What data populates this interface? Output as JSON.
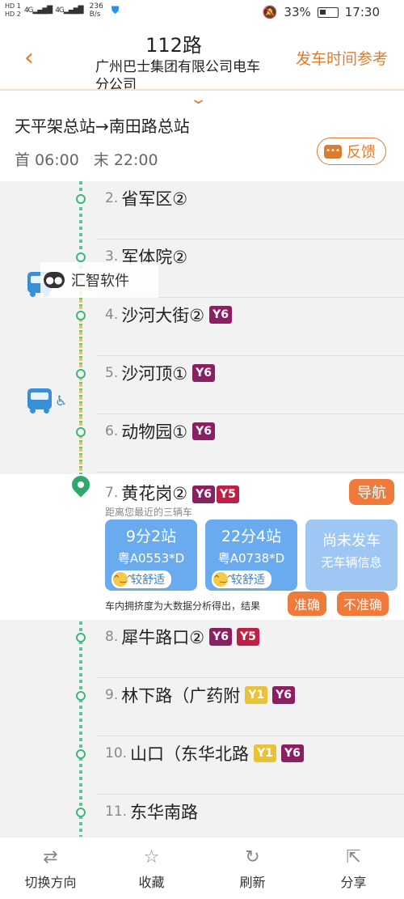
{
  "status_bar": {
    "hd1": "HD 1",
    "hd2": "HD 2",
    "sig1": "4G",
    "sig2": "4G",
    "speed_value": "236",
    "speed_unit": "B/s",
    "battery": "33%",
    "time": "17:30"
  },
  "header": {
    "route_number": "112路",
    "company": "广州巴士集团有限公司电车分公司",
    "timetable_label": "发车时间参考"
  },
  "route": {
    "direction": "天平架总站→南田路总站",
    "first_bus": "首 06:00",
    "last_bus": "末 22:00",
    "feedback_label": "反馈"
  },
  "watermark": {
    "text": "汇智软件"
  },
  "stations": [
    {
      "num": "2.",
      "name": "省军区②",
      "tags": []
    },
    {
      "num": "3.",
      "name": "军体院②",
      "tags": []
    },
    {
      "num": "4.",
      "name": "沙河大街②",
      "tags": [
        {
          "text": "Y6",
          "color": "#8a1f62"
        }
      ]
    },
    {
      "num": "5.",
      "name": "沙河顶①",
      "tags": [
        {
          "text": "Y6",
          "color": "#8a1f62"
        }
      ]
    },
    {
      "num": "6.",
      "name": "动物园①",
      "tags": [
        {
          "text": "Y6",
          "color": "#8a1f62"
        }
      ]
    }
  ],
  "current_station": {
    "num": "7.",
    "name": "黄花岗②",
    "tags": [
      {
        "text": "Y6",
        "color": "#8a1f62"
      },
      {
        "text": "Y5",
        "color": "#c12046"
      }
    ],
    "nav_label": "导航",
    "hint": "距离您最近的三辆车",
    "buses": [
      {
        "eta": "9分2站",
        "plate": "粤A0553*D",
        "comfort": "较舒适"
      },
      {
        "eta": "22分4站",
        "plate": "粤A0738*D",
        "comfort": "较舒适"
      }
    ],
    "no_bus": {
      "line1": "尚未发车",
      "line2": "无车辆信息"
    },
    "crowd_note": "车内拥挤度为大数据分析得出，结果",
    "accurate_label": "准确",
    "inaccurate_label": "不准确"
  },
  "stations_after": [
    {
      "num": "8.",
      "name": "犀牛路口②",
      "tags": [
        {
          "text": "Y6",
          "color": "#8a1f62"
        },
        {
          "text": "Y5",
          "color": "#c12046"
        }
      ]
    },
    {
      "num": "9.",
      "name": "林下路（广药附",
      "tags": [
        {
          "text": "Y1",
          "color": "#e8c33a"
        },
        {
          "text": "Y6",
          "color": "#8a1f62"
        }
      ]
    },
    {
      "num": "10.",
      "name": "山口（东华北路",
      "tags": [
        {
          "text": "Y1",
          "color": "#e8c33a"
        },
        {
          "text": "Y6",
          "color": "#8a1f62"
        }
      ]
    },
    {
      "num": "11.",
      "name": "东华南路",
      "tags": []
    }
  ],
  "bottom_tabs": [
    {
      "label": "切换方向",
      "icon": "switch-direction-icon"
    },
    {
      "label": "收藏",
      "icon": "star-icon"
    },
    {
      "label": "刷新",
      "icon": "refresh-icon"
    },
    {
      "label": "分享",
      "icon": "share-icon"
    }
  ]
}
